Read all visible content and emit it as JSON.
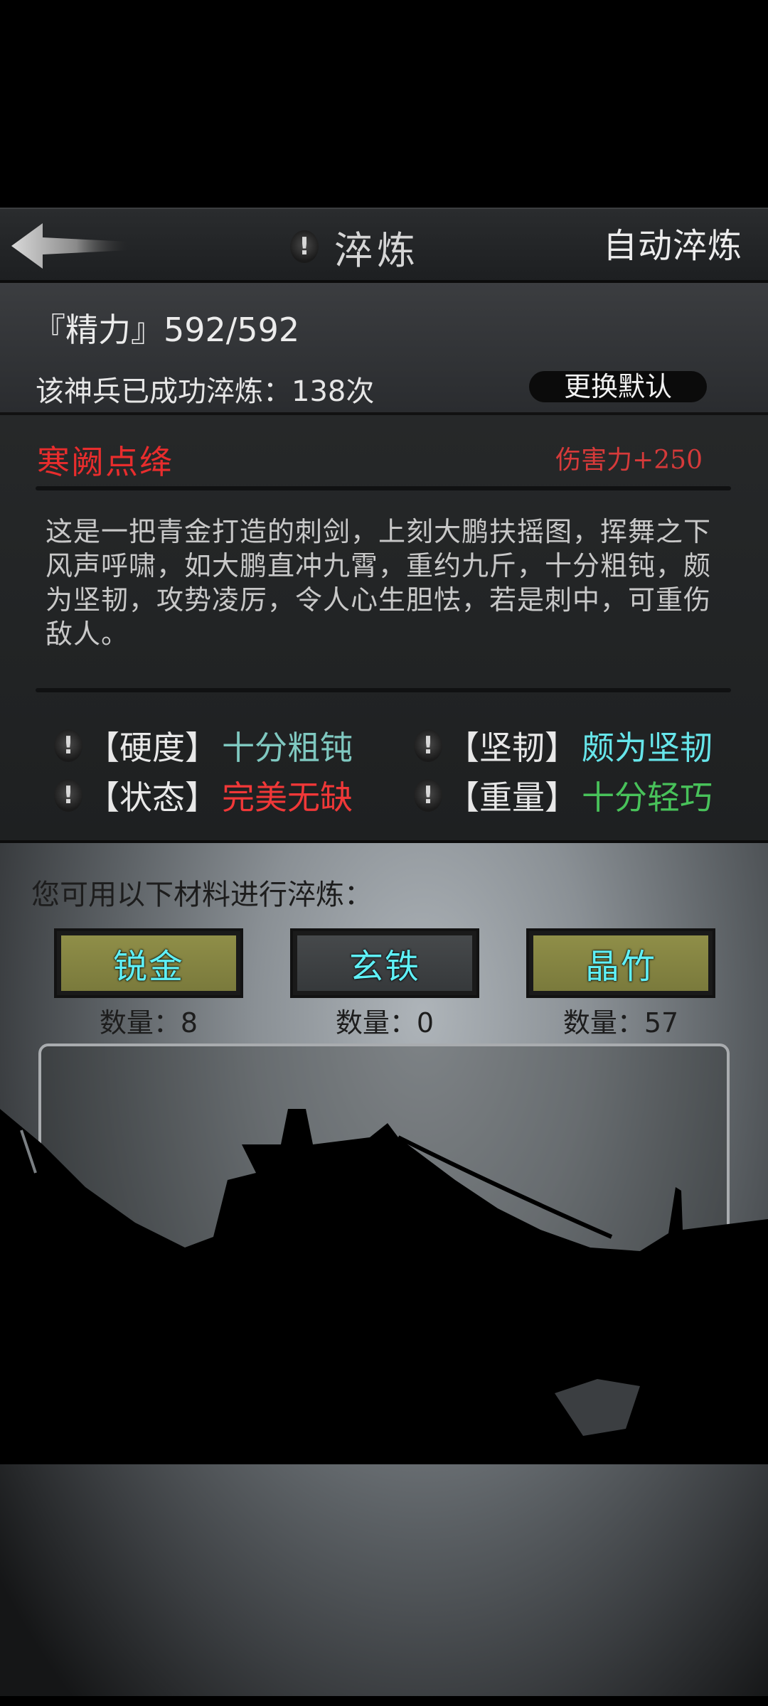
{
  "header": {
    "back_icon": "arrow-left-icon",
    "title": "淬炼",
    "auto_label": "自动淬炼"
  },
  "energy": {
    "label_prefix": "『精力』",
    "value": "592/592",
    "forge_count_text": "该神兵已成功淬炼：138次",
    "change_default_label": "更换默认"
  },
  "weapon": {
    "name": "寒阙点绛",
    "damage": "伤害力+250",
    "description": "这是一把青金打造的刺剑，上刻大鹏扶摇图，挥舞之下风声呼啸，如大鹏直冲九霄，重约九斤，十分粗钝，颇为坚韧，攻势凌厉，令人心生胆怯，若是刺中，可重伤敌人。",
    "attributes": [
      {
        "label": "【硬度】",
        "value": "十分粗钝",
        "color": "#7fc8c0"
      },
      {
        "label": "【坚韧】",
        "value": "颇为坚韧",
        "color": "#66e5ea"
      },
      {
        "label": "【状态】",
        "value": "完美无缺",
        "color": "#f03838"
      },
      {
        "label": "【重量】",
        "value": "十分轻巧",
        "color": "#48c25a"
      }
    ]
  },
  "materials": {
    "prompt": "您可用以下材料进行淬炼：",
    "items": [
      {
        "name": "锐金",
        "count_text": "数量：8"
      },
      {
        "name": "玄铁",
        "count_text": "数量：0"
      },
      {
        "name": "晶竹",
        "count_text": "数量：57"
      }
    ]
  },
  "colors": {
    "weapon_name": "#e82d2d",
    "material_label": "#5ff0f6",
    "material_available": "#8f8e48",
    "material_empty": "#46494b"
  }
}
